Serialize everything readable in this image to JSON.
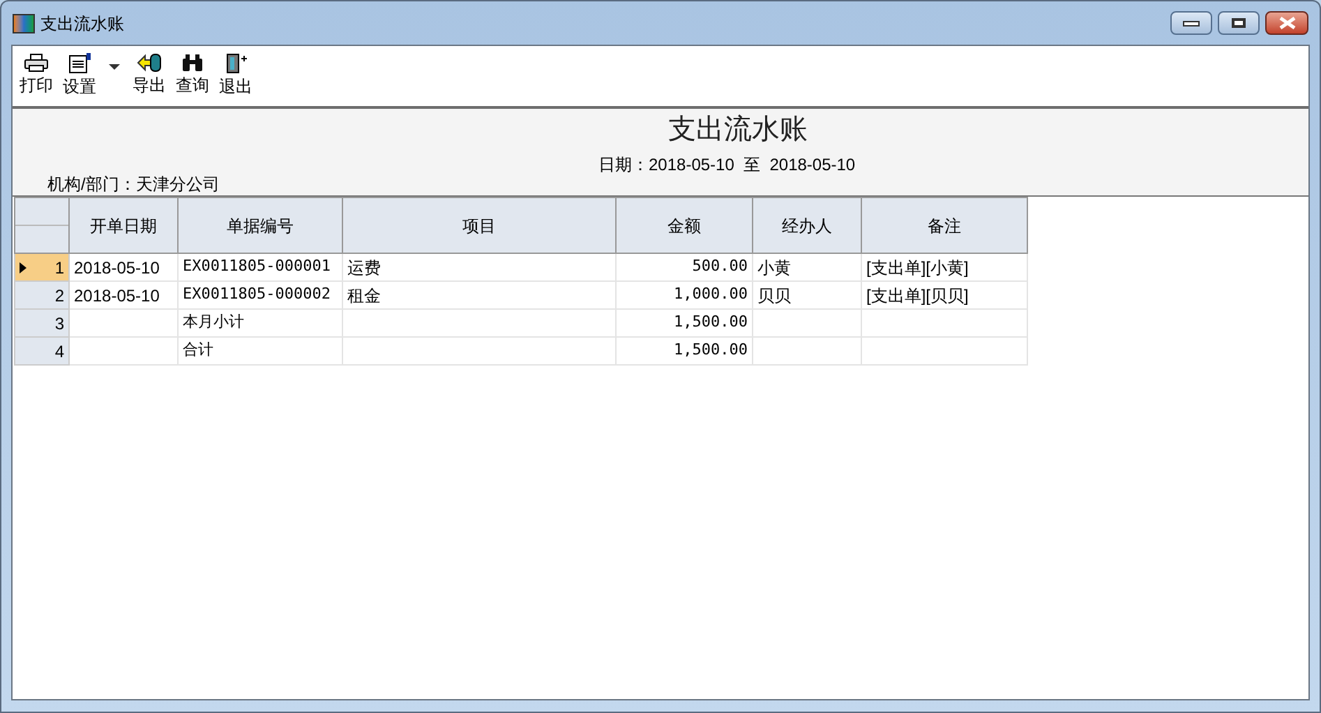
{
  "window": {
    "title": "支出流水账"
  },
  "toolbar": [
    {
      "label": "打印",
      "kind": "printer"
    },
    {
      "label": "设置",
      "kind": "settings",
      "dropdown": true
    },
    {
      "label": "导出",
      "kind": "export"
    },
    {
      "label": "查询",
      "kind": "binoculars"
    },
    {
      "label": "退出",
      "kind": "exit"
    }
  ],
  "report": {
    "title": "支出流水账",
    "date_range": "日期：2018-05-10  至  2018-05-10",
    "department": "机构/部门：天津分公司"
  },
  "table": {
    "columns": [
      "开单日期",
      "单据编号",
      "项目",
      "金额",
      "经办人",
      "备注"
    ],
    "rows": [
      {
        "number": "1",
        "selected": true,
        "cells": [
          "2018-05-10",
          "EX0011805-000001",
          "运费",
          "500.00",
          "小黄",
          "[支出单][小黄]"
        ]
      },
      {
        "number": "2",
        "selected": false,
        "cells": [
          "2018-05-10",
          "EX0011805-000002",
          "租金",
          "1,000.00",
          "贝贝",
          "[支出单][贝贝]"
        ]
      },
      {
        "number": "3",
        "selected": false,
        "cells": [
          "",
          "本月小计",
          "",
          "1,500.00",
          "",
          ""
        ]
      },
      {
        "number": "4",
        "selected": false,
        "cells": [
          "",
          "合计",
          "",
          "1,500.00",
          "",
          ""
        ]
      }
    ]
  }
}
